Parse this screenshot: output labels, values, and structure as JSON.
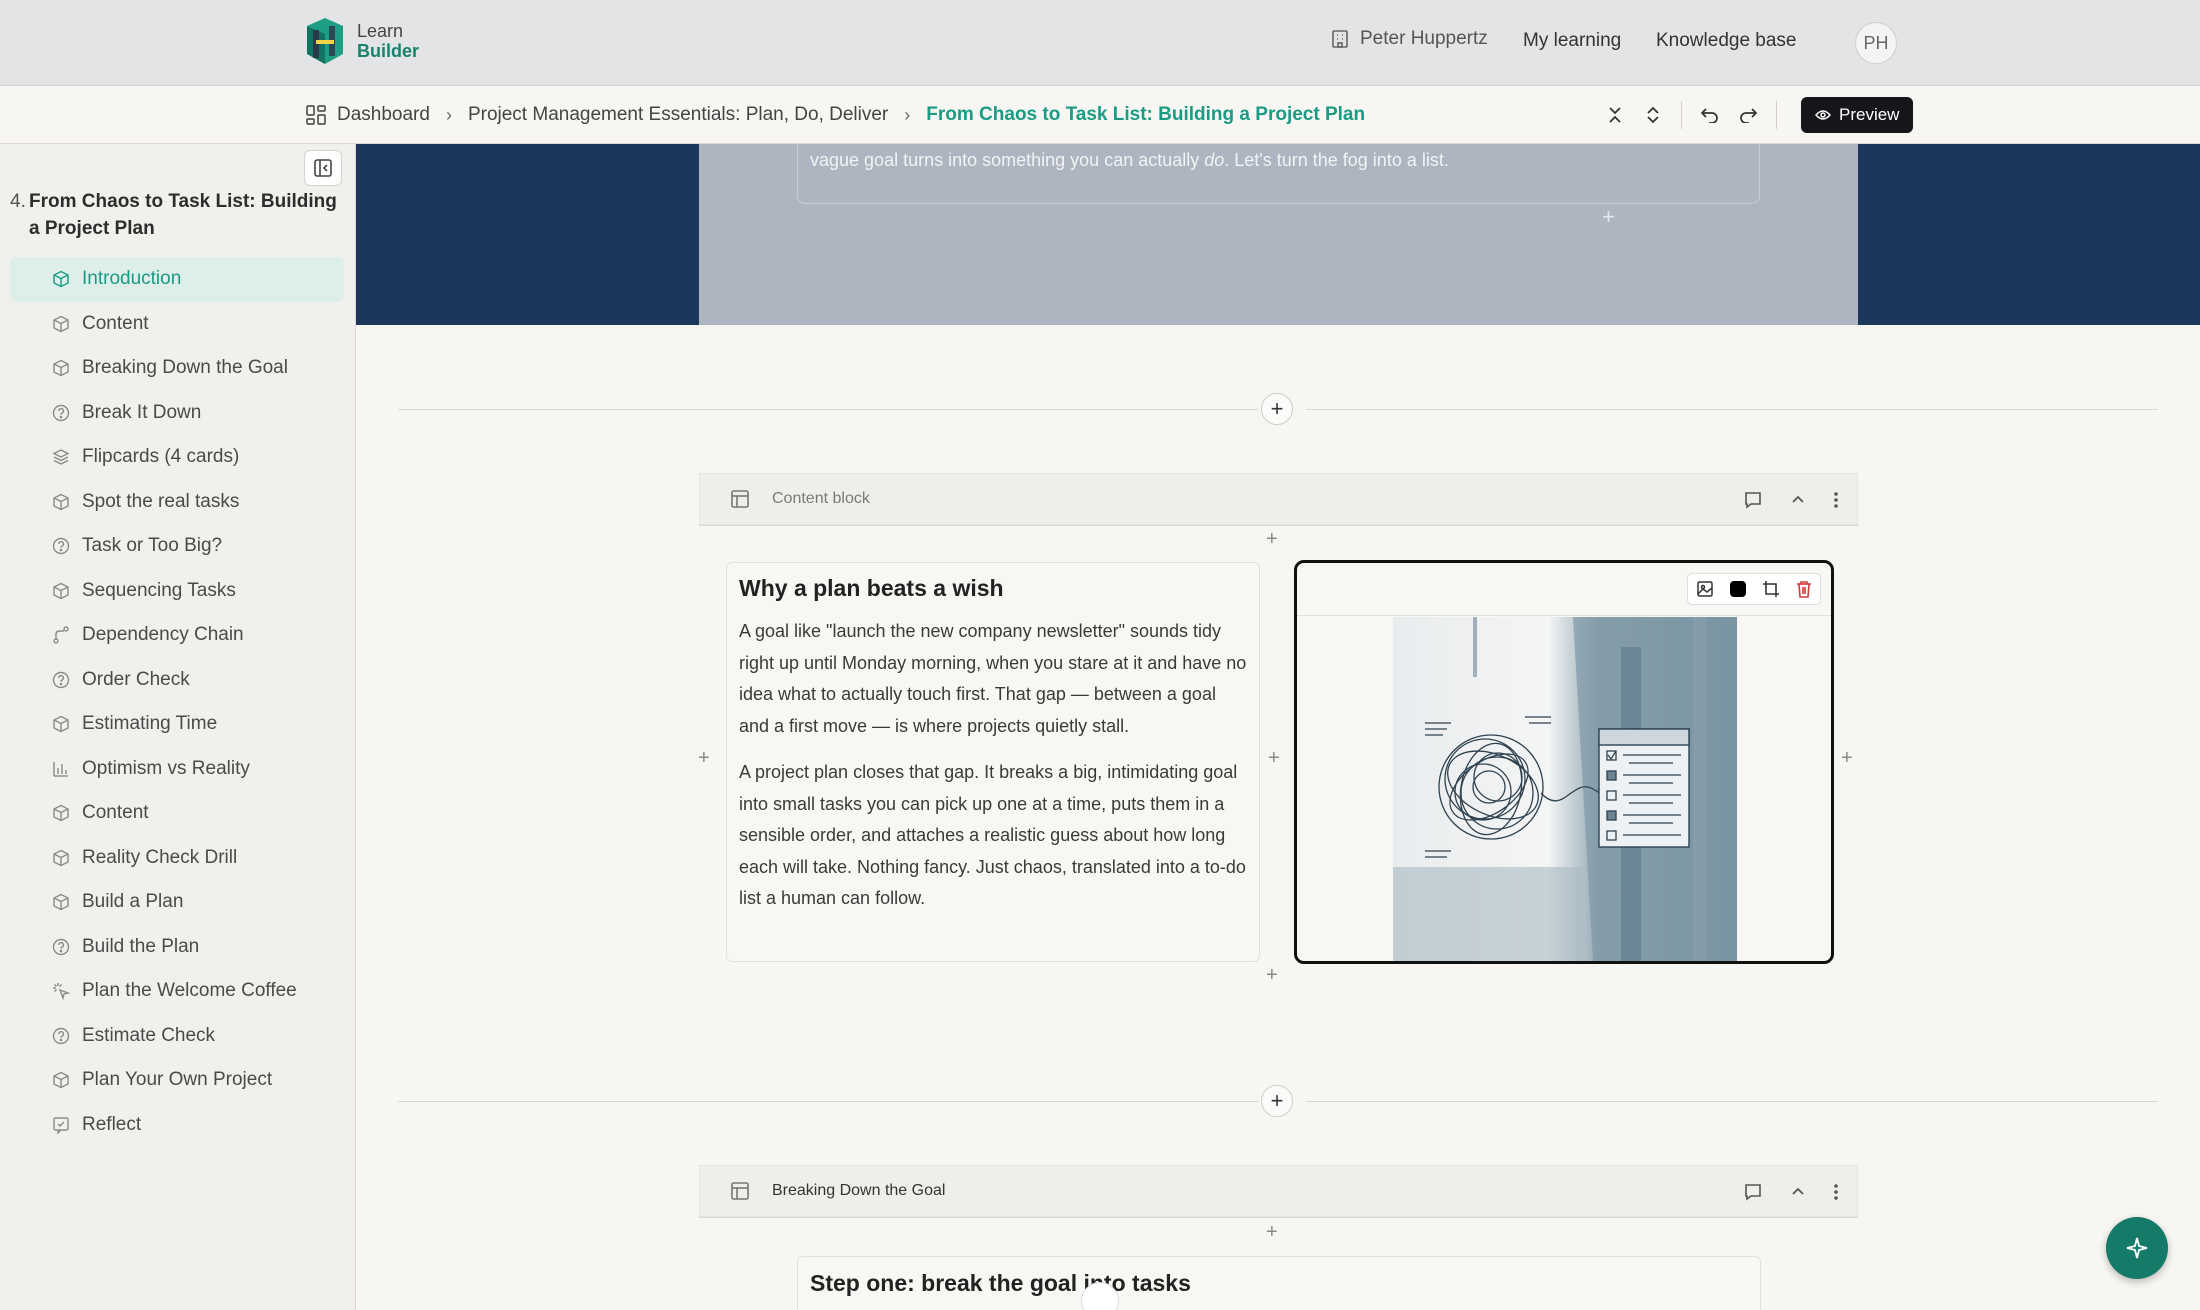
{
  "app": {
    "logo_line1": "Learn",
    "logo_line2": "Builder"
  },
  "topnav": {
    "org_name": "Peter Huppertz",
    "my_learning": "My learning",
    "knowledge_base": "Knowledge base",
    "avatar_initials": "PH"
  },
  "breadcrumb": {
    "dashboard": "Dashboard",
    "course": "Project Management Essentials: Plan, Do, Deliver",
    "lesson": "From Chaos to Task List: Building a Project Plan"
  },
  "toolbar": {
    "preview_label": "Preview"
  },
  "sidebar": {
    "section_number": "4.",
    "section_title": "From Chaos to Task List: Building a Project Plan",
    "items": [
      {
        "label": "Introduction",
        "icon": "cube-icon",
        "active": true
      },
      {
        "label": "Content",
        "icon": "cube-icon"
      },
      {
        "label": "Breaking Down the Goal",
        "icon": "cube-icon"
      },
      {
        "label": "Break It Down",
        "icon": "question-circle-icon"
      },
      {
        "label": "Flipcards (4 cards)",
        "icon": "layers-icon"
      },
      {
        "label": "Spot the real tasks",
        "icon": "cube-icon"
      },
      {
        "label": "Task or Too Big?",
        "icon": "question-circle-icon"
      },
      {
        "label": "Sequencing Tasks",
        "icon": "cube-icon"
      },
      {
        "label": "Dependency Chain",
        "icon": "branch-icon"
      },
      {
        "label": "Order Check",
        "icon": "question-circle-icon"
      },
      {
        "label": "Estimating Time",
        "icon": "cube-icon"
      },
      {
        "label": "Optimism vs Reality",
        "icon": "bar-chart-icon"
      },
      {
        "label": "Content",
        "icon": "cube-icon"
      },
      {
        "label": "Reality Check Drill",
        "icon": "cube-icon"
      },
      {
        "label": "Build a Plan",
        "icon": "cube-icon"
      },
      {
        "label": "Build the Plan",
        "icon": "question-circle-icon"
      },
      {
        "label": "Plan the Welcome Coffee",
        "icon": "sparkle-click-icon"
      },
      {
        "label": "Estimate Check",
        "icon": "question-circle-icon"
      },
      {
        "label": "Plan Your Own Project",
        "icon": "cube-icon"
      },
      {
        "label": "Reflect",
        "icon": "chat-square-icon"
      }
    ]
  },
  "hero": {
    "text_before": "vague goal turns into something you can actually ",
    "text_em": "do",
    "text_after": ". Let's turn the fog into a list."
  },
  "block1": {
    "header": "Content block",
    "heading": "Why a plan beats a wish",
    "paragraph1": "A goal like \"launch the new company newsletter\" sounds tidy right up until Monday morning, when you stare at it and have no idea what to actually touch first. That gap — between a goal and a first move — is where projects quietly stall.",
    "paragraph2": "A project plan closes that gap. It breaks a big, intimidating goal into small tasks you can pick up one at a time, puts them in a sensible order, and attaches a realistic guess about how long each will take. Nothing fancy. Just chaos, translated into a to-do list a human can follow."
  },
  "block2": {
    "header": "Breaking Down the Goal",
    "heading": "Step one: break the goal into tasks"
  },
  "colors": {
    "accent": "#1a9b84",
    "hero_bg": "#1d375c",
    "fab_bg": "#157a67"
  }
}
